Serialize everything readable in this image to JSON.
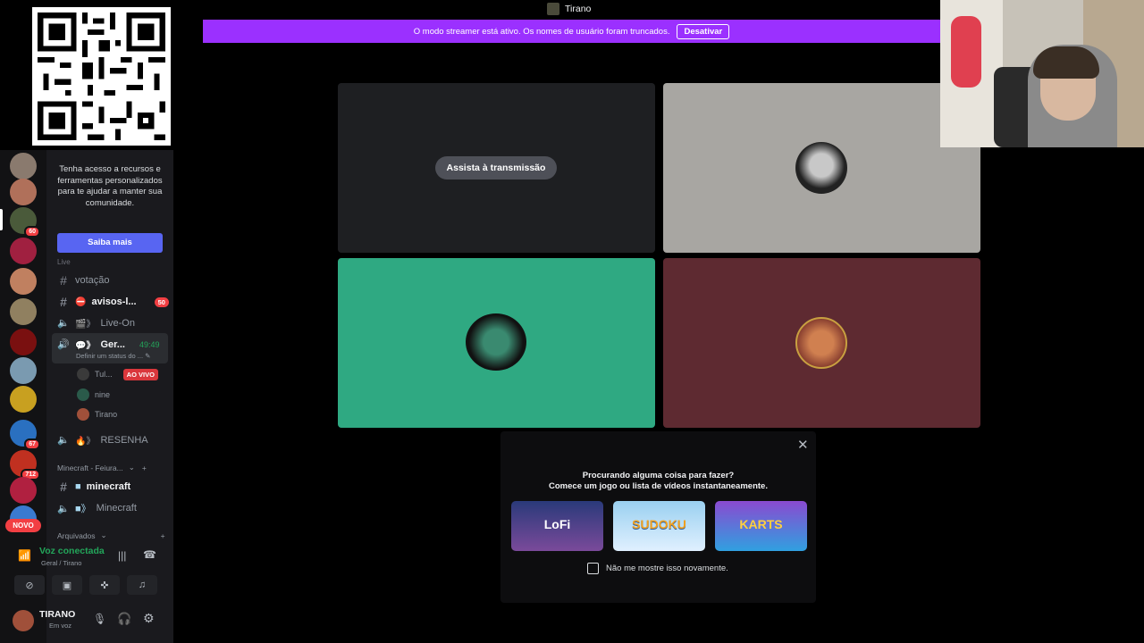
{
  "titlebar": {
    "title": "Tirano"
  },
  "banner": {
    "message": "O modo streamer está ativo. Os nomes de usuário foram truncados.",
    "button": "Desativar"
  },
  "promo": {
    "text": "Tenha acesso a recursos e ferramentas personalizados para te ajudar a manter sua comunidade.",
    "button": "Saiba mais"
  },
  "rail": {
    "badges": [
      "60",
      "67",
      "712"
    ],
    "new_label": "NOVO"
  },
  "channels": {
    "category_live": "Live",
    "votacao": "votação",
    "avisos": "avisos-l...",
    "avisos_badge": "50",
    "live_on": "Live-On",
    "geral": "Ger...",
    "geral_timer": "49:49",
    "geral_status": "Definir um status do ...",
    "users": [
      {
        "name": "Tul...",
        "live": "AO VIVO"
      },
      {
        "name": "nine"
      },
      {
        "name": "Tirano"
      }
    ],
    "resenha": "RESENHA",
    "category_minecraft": "Minecraft - Feiura...",
    "minecraft_text": "minecraft",
    "minecraft_voice": "Minecraft",
    "category_archived": "Arquivados"
  },
  "voice": {
    "status": "Voz conectada",
    "location": "Geral / Tirano"
  },
  "user": {
    "name": "TIRANO",
    "status": "Em voz"
  },
  "stage": {
    "watch_button": "Assista à transmissão",
    "tile_colors": [
      "#1e1f22",
      "#a8a6a2",
      "#2fa982",
      "#5e2a31"
    ]
  },
  "activity": {
    "line1": "Procurando alguma coisa para fazer?",
    "line2": "Comece um jogo ou lista de vídeos instantaneamente.",
    "cards": [
      "LoFi",
      "SUDOKU",
      "KARTS"
    ],
    "checkbox_label": "Não me mostre isso novamente."
  }
}
